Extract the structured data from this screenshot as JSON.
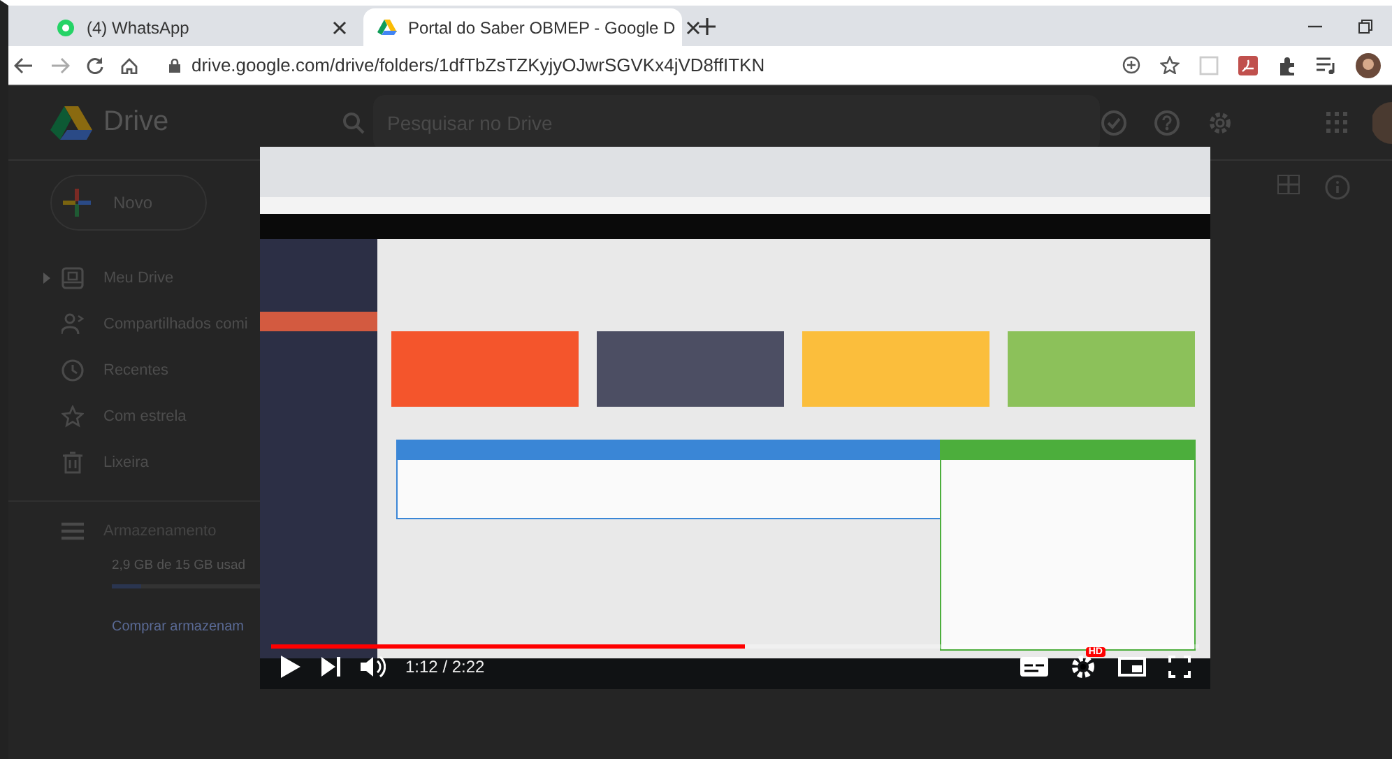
{
  "browser": {
    "tabs": [
      {
        "title": "(4) WhatsApp",
        "selected": false
      },
      {
        "title": "Portal do Saber OBMEP - Google D",
        "selected": true
      }
    ],
    "url": "drive.google.com/drive/folders/1dfTbZsTZKyjyOJwrSGVKx4jVD8ffITKN"
  },
  "drive": {
    "app_name": "Drive",
    "search": {
      "placeholder": "Pesquisar no Drive"
    },
    "new_button": "Novo",
    "sidebar": {
      "items": [
        {
          "label": "Meu Drive",
          "kind": "drive",
          "expandable": true
        },
        {
          "label": "Compartilhados comi",
          "kind": "shared",
          "expandable": false
        },
        {
          "label": "Recentes",
          "kind": "recent",
          "expandable": false
        },
        {
          "label": "Com estrela",
          "kind": "starred",
          "expandable": false
        },
        {
          "label": "Lixeira",
          "kind": "trash",
          "expandable": false
        }
      ]
    },
    "storage": {
      "label": "Armazenamento",
      "usage": "2,9 GB de 15 GB usad",
      "level": 0.2,
      "buy": "Comprar armazenam"
    }
  },
  "video": {
    "progress": {
      "level": 0.51
    },
    "time": "1:12 / 2:22",
    "hd_badge": "HD"
  }
}
